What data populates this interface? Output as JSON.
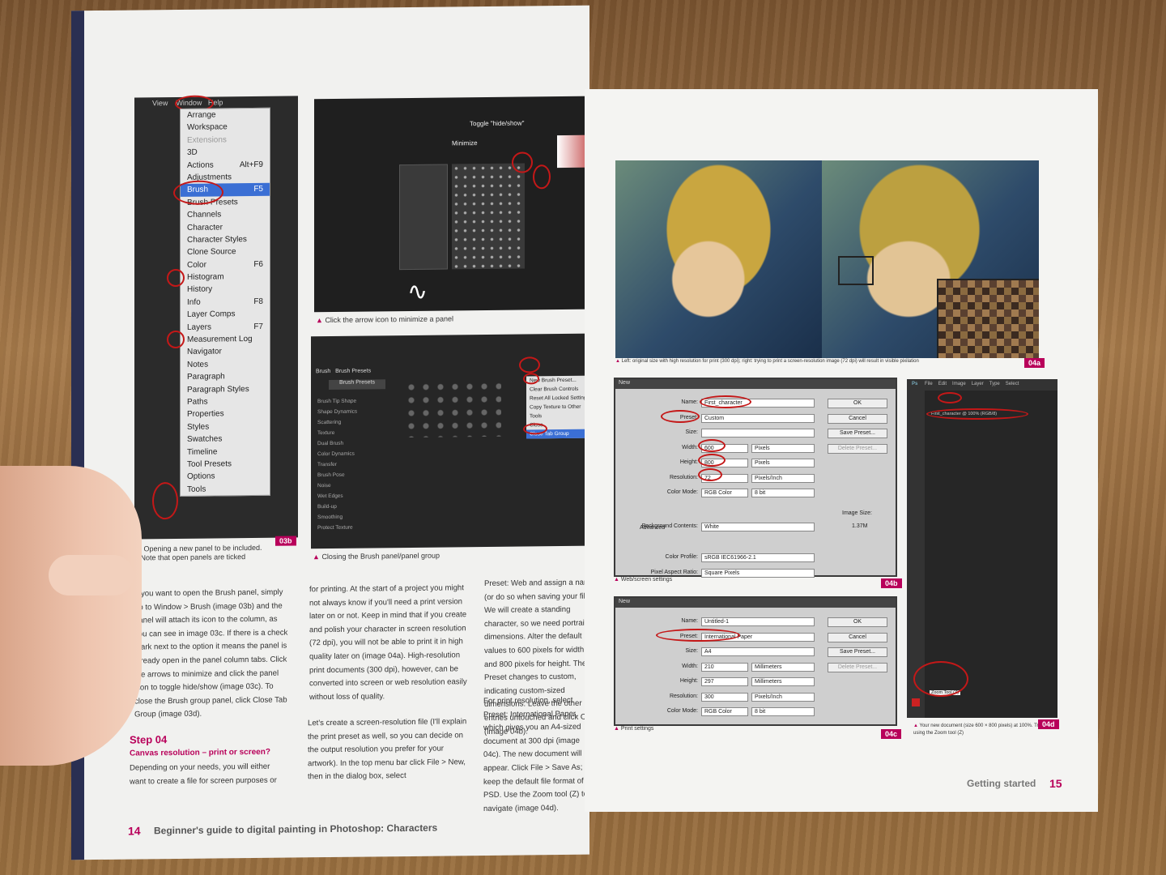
{
  "left_page": {
    "menubar": {
      "items": [
        "View",
        "Window",
        "Help"
      ]
    },
    "window_menu": [
      {
        "label": "Arrange",
        "shortcut": ""
      },
      {
        "label": "Workspace",
        "shortcut": ""
      },
      {
        "label": "Extensions",
        "shortcut": ""
      },
      {
        "label": "3D",
        "shortcut": ""
      },
      {
        "label": "Actions",
        "shortcut": "Alt+F9"
      },
      {
        "label": "Adjustments",
        "shortcut": ""
      },
      {
        "label": "Brush",
        "shortcut": "F5"
      },
      {
        "label": "Brush Presets",
        "shortcut": ""
      },
      {
        "label": "Channels",
        "shortcut": ""
      },
      {
        "label": "Character",
        "shortcut": ""
      },
      {
        "label": "Character Styles",
        "shortcut": ""
      },
      {
        "label": "Clone Source",
        "shortcut": ""
      },
      {
        "label": "Color",
        "shortcut": "F6"
      },
      {
        "label": "Histogram",
        "shortcut": ""
      },
      {
        "label": "History",
        "shortcut": ""
      },
      {
        "label": "Info",
        "shortcut": "F8"
      },
      {
        "label": "Layer Comps",
        "shortcut": ""
      },
      {
        "label": "Layers",
        "shortcut": "F7"
      },
      {
        "label": "Measurement Log",
        "shortcut": ""
      },
      {
        "label": "Navigator",
        "shortcut": ""
      },
      {
        "label": "Notes",
        "shortcut": ""
      },
      {
        "label": "Paragraph",
        "shortcut": ""
      },
      {
        "label": "Paragraph Styles",
        "shortcut": ""
      },
      {
        "label": "Paths",
        "shortcut": ""
      },
      {
        "label": "Properties",
        "shortcut": ""
      },
      {
        "label": "Styles",
        "shortcut": ""
      },
      {
        "label": "Swatches",
        "shortcut": ""
      },
      {
        "label": "Timeline",
        "shortcut": ""
      },
      {
        "label": "Tool Presets",
        "shortcut": ""
      },
      {
        "label": "Options",
        "shortcut": ""
      },
      {
        "label": "Tools",
        "shortcut": ""
      }
    ],
    "img_03c": {
      "toggle_label": "Toggle \"hide/show\"",
      "minimize_label": "Minimize",
      "caption": "Click the arrow icon to minimize a panel"
    },
    "img_03d": {
      "tabs": [
        "Brush",
        "Brush Presets"
      ],
      "presets_button": "Brush Presets",
      "options": [
        "Brush Tip Shape",
        "Shape Dynamics",
        "Scattering",
        "Texture",
        "Dual Brush",
        "Color Dynamics",
        "Transfer",
        "Brush Pose",
        "Noise",
        "Wet Edges",
        "Build-up",
        "Smoothing",
        "Protect Texture"
      ],
      "context_menu": [
        "New Brush Preset...",
        "Clear Brush Controls",
        "Reset All Locked Settings",
        "Copy Texture to Other Tools",
        "Close",
        "Close Tab Group"
      ],
      "caption": "Closing the Brush panel/panel group"
    },
    "img_03b": {
      "caption_line1": "Opening a new panel to be included.",
      "caption_line2": "Note that open panels are ticked",
      "tag": "03b"
    },
    "col1": "If you want to open the Brush panel, simply go to Window > Brush (image 03b) and the panel will attach its icon to the column, as you can see in image 03c. If there is a check mark next to the option it means the panel is already open in the panel column tabs. Click the arrows to minimize and click the panel icon to toggle hide/show (image 03c). To close the Brush group panel, click Close Tab Group (image 03d).",
    "step": {
      "title": "Step 04",
      "subtitle": "Canvas resolution – print or screen?"
    },
    "col1_after": "Depending on your needs, you will either want to create a file for screen purposes or",
    "col2_p1": "for printing. At the start of a project you might not always know if you'll need a print version later on or not. Keep in mind that if you create and polish your character in screen resolution (72 dpi), you will not be able to print it in high quality later on (image 04a). High-resolution print documents (300 dpi), however, can be converted into screen or web resolution easily without loss of quality.",
    "col2_p2": "Let's create a screen-resolution file (I'll explain the print preset as well, so you can decide on the output resolution you prefer for your artwork). In the top menu bar click File > New, then in the dialog box, select",
    "col3_p1": "Preset: Web and assign a name (or do so when saving your file). We will create a standing character, so we need portrait dimensions. Alter the default values to 600 pixels for width and 800 pixels for height. The Preset changes to custom, indicating custom-sized dimensions. Leave the other entries untouched and click OK (image 04b).",
    "col3_p2": "For print resolution, select Preset: International Paper, which gives you an A4-sized document at 300 dpi (image 04c). The new document will appear. Click File > Save As; keep the default file format of PSD. Use the Zoom tool (Z) to navigate (image 04d).",
    "page_number": "14",
    "book_title": "Beginner's guide to digital painting in Photoshop: Characters"
  },
  "right_page": {
    "img_04a": {
      "caption": "Left: original size with high resolution for print (300 dpi); right: trying to print a screen-resolution image (72 dpi) will result in visible pixilation",
      "tag": "04a"
    },
    "img_04b": {
      "title": "New",
      "fields": [
        {
          "label": "Name:",
          "value": "First_character"
        },
        {
          "label": "Preset:",
          "value": "Custom"
        },
        {
          "label": "Size:",
          "value": ""
        },
        {
          "label": "Width:",
          "value": "600",
          "unit": "Pixels"
        },
        {
          "label": "Height:",
          "value": "800",
          "unit": "Pixels"
        },
        {
          "label": "Resolution:",
          "value": "72",
          "unit": "Pixels/Inch"
        },
        {
          "label": "Color Mode:",
          "value": "RGB Color",
          "unit": "8 bit"
        },
        {
          "label": "Background Contents:",
          "value": "White"
        },
        {
          "label": "Color Profile:",
          "value": "sRGB IEC61966-2.1"
        },
        {
          "label": "Pixel Aspect Ratio:",
          "value": "Square Pixels"
        }
      ],
      "advanced": "Advanced",
      "buttons": [
        "OK",
        "Cancel",
        "Save Preset...",
        "Delete Preset..."
      ],
      "image_size_label": "Image Size:",
      "image_size_value": "1.37M",
      "caption": "Web/screen settings",
      "tag": "04b"
    },
    "img_04c": {
      "title": "New",
      "fields": [
        {
          "label": "Name:",
          "value": "Untitled-1"
        },
        {
          "label": "Preset:",
          "value": "International Paper"
        },
        {
          "label": "Size:",
          "value": "A4"
        },
        {
          "label": "Width:",
          "value": "210",
          "unit": "Millimeters"
        },
        {
          "label": "Height:",
          "value": "297",
          "unit": "Millimeters"
        },
        {
          "label": "Resolution:",
          "value": "300",
          "unit": "Pixels/Inch"
        },
        {
          "label": "Color Mode:",
          "value": "RGB Color",
          "unit": "8 bit"
        }
      ],
      "buttons": [
        "OK",
        "Cancel",
        "Save Preset...",
        "Delete Preset..."
      ],
      "caption": "Print settings",
      "tag": "04c"
    },
    "img_04d": {
      "menu": [
        "File",
        "Edit",
        "Image",
        "Layer",
        "Type",
        "Select"
      ],
      "doc_tab": "First_character @ 100% (RGB/8)",
      "tooltip": "Zoom Tool (Z)",
      "caption": "Your new document (size 600 × 800 pixels) at 100%. Try using the Zoom tool (Z)",
      "tag": "04d"
    },
    "section": "Getting started",
    "page_number": "15"
  }
}
